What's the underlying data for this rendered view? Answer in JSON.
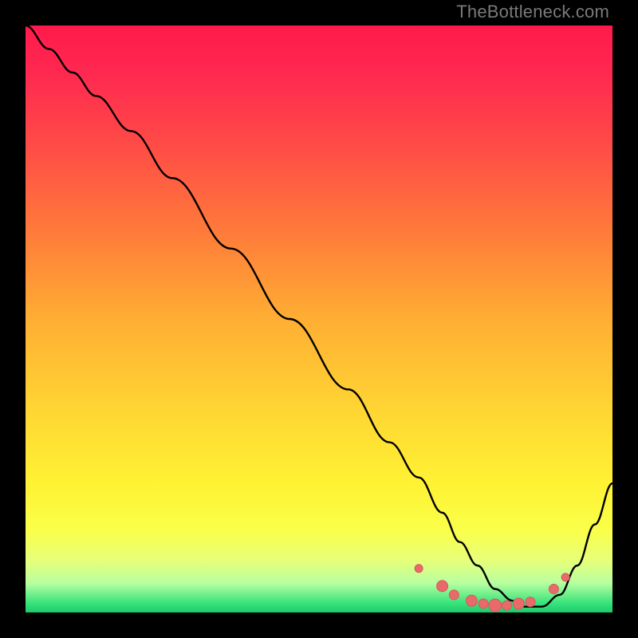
{
  "watermark": "TheBottleneck.com",
  "colors": {
    "gradient_stops": [
      {
        "offset": 0.0,
        "color": "#ff1a4b"
      },
      {
        "offset": 0.08,
        "color": "#ff2850"
      },
      {
        "offset": 0.2,
        "color": "#ff4a47"
      },
      {
        "offset": 0.35,
        "color": "#ff7a3a"
      },
      {
        "offset": 0.5,
        "color": "#ffae33"
      },
      {
        "offset": 0.65,
        "color": "#ffd433"
      },
      {
        "offset": 0.78,
        "color": "#fff233"
      },
      {
        "offset": 0.86,
        "color": "#faff4a"
      },
      {
        "offset": 0.91,
        "color": "#e8ff78"
      },
      {
        "offset": 0.95,
        "color": "#b8ffa0"
      },
      {
        "offset": 0.985,
        "color": "#35e27a"
      },
      {
        "offset": 1.0,
        "color": "#1fc96c"
      }
    ],
    "curve": "#000000",
    "marker_fill": "#e86a6a",
    "marker_stroke": "#d65a5a"
  },
  "chart_data": {
    "type": "line",
    "title": "",
    "xlabel": "",
    "ylabel": "",
    "xlim": [
      0,
      100
    ],
    "ylim": [
      0,
      100
    ],
    "series": [
      {
        "name": "bottleneck-curve",
        "x": [
          0,
          4,
          8,
          12,
          18,
          25,
          35,
          45,
          55,
          62,
          67,
          71,
          74,
          77,
          80,
          83,
          85,
          88,
          91,
          94,
          97,
          100
        ],
        "y": [
          100,
          96,
          92,
          88,
          82,
          74,
          62,
          50,
          38,
          29,
          23,
          17,
          12,
          8,
          4,
          2,
          1,
          1,
          3,
          8,
          15,
          22
        ]
      }
    ],
    "markers": {
      "name": "highlight-dots",
      "x": [
        67,
        71,
        73,
        76,
        78,
        80,
        82,
        84,
        86,
        90,
        92
      ],
      "y": [
        7.5,
        4.5,
        3,
        2,
        1.5,
        1.2,
        1.2,
        1.5,
        1.8,
        4,
        6
      ],
      "r": [
        5,
        7,
        6,
        7,
        6,
        8,
        6,
        7,
        6,
        6,
        5
      ]
    }
  }
}
